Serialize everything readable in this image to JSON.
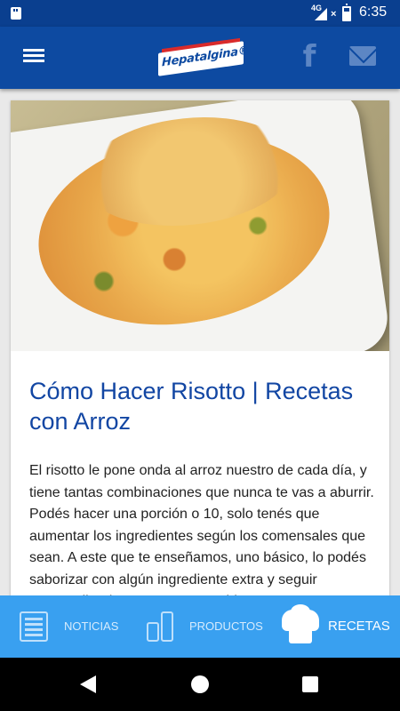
{
  "status_bar": {
    "network": "4G",
    "time": "6:35"
  },
  "app_bar": {
    "logo_text": "Hepatalgina®",
    "facebook_glyph": "f",
    "icons": [
      "menu-icon",
      "facebook-icon",
      "mail-icon"
    ]
  },
  "article": {
    "title": "Cómo Hacer Risotto | Recetas con Arroz",
    "body": "El risotto le pone onda al arroz nuestro de cada día, y tiene tantas combinaciones que nunca te vas a aburrir. Podés hacer una porción o 10, solo tenés que aumentar los ingredientes según los comensales que sean. A este que te enseñamos, uno básico, lo podés saborizar con algún ingrediente extra y seguir sorprendiendo a tus seres queridos."
  },
  "bottom_nav": {
    "items": [
      {
        "label": "NOTICIAS",
        "icon": "newspaper-icon"
      },
      {
        "label": "PRODUCTOS",
        "icon": "bottles-icon"
      },
      {
        "label": "RECETAS",
        "icon": "chef-hat-icon",
        "active": true
      }
    ]
  },
  "colors": {
    "status_bar": "#0a3f8f",
    "app_bar": "#0d4aa1",
    "title": "#1246a3",
    "bottom_nav": "#39a0f0"
  }
}
